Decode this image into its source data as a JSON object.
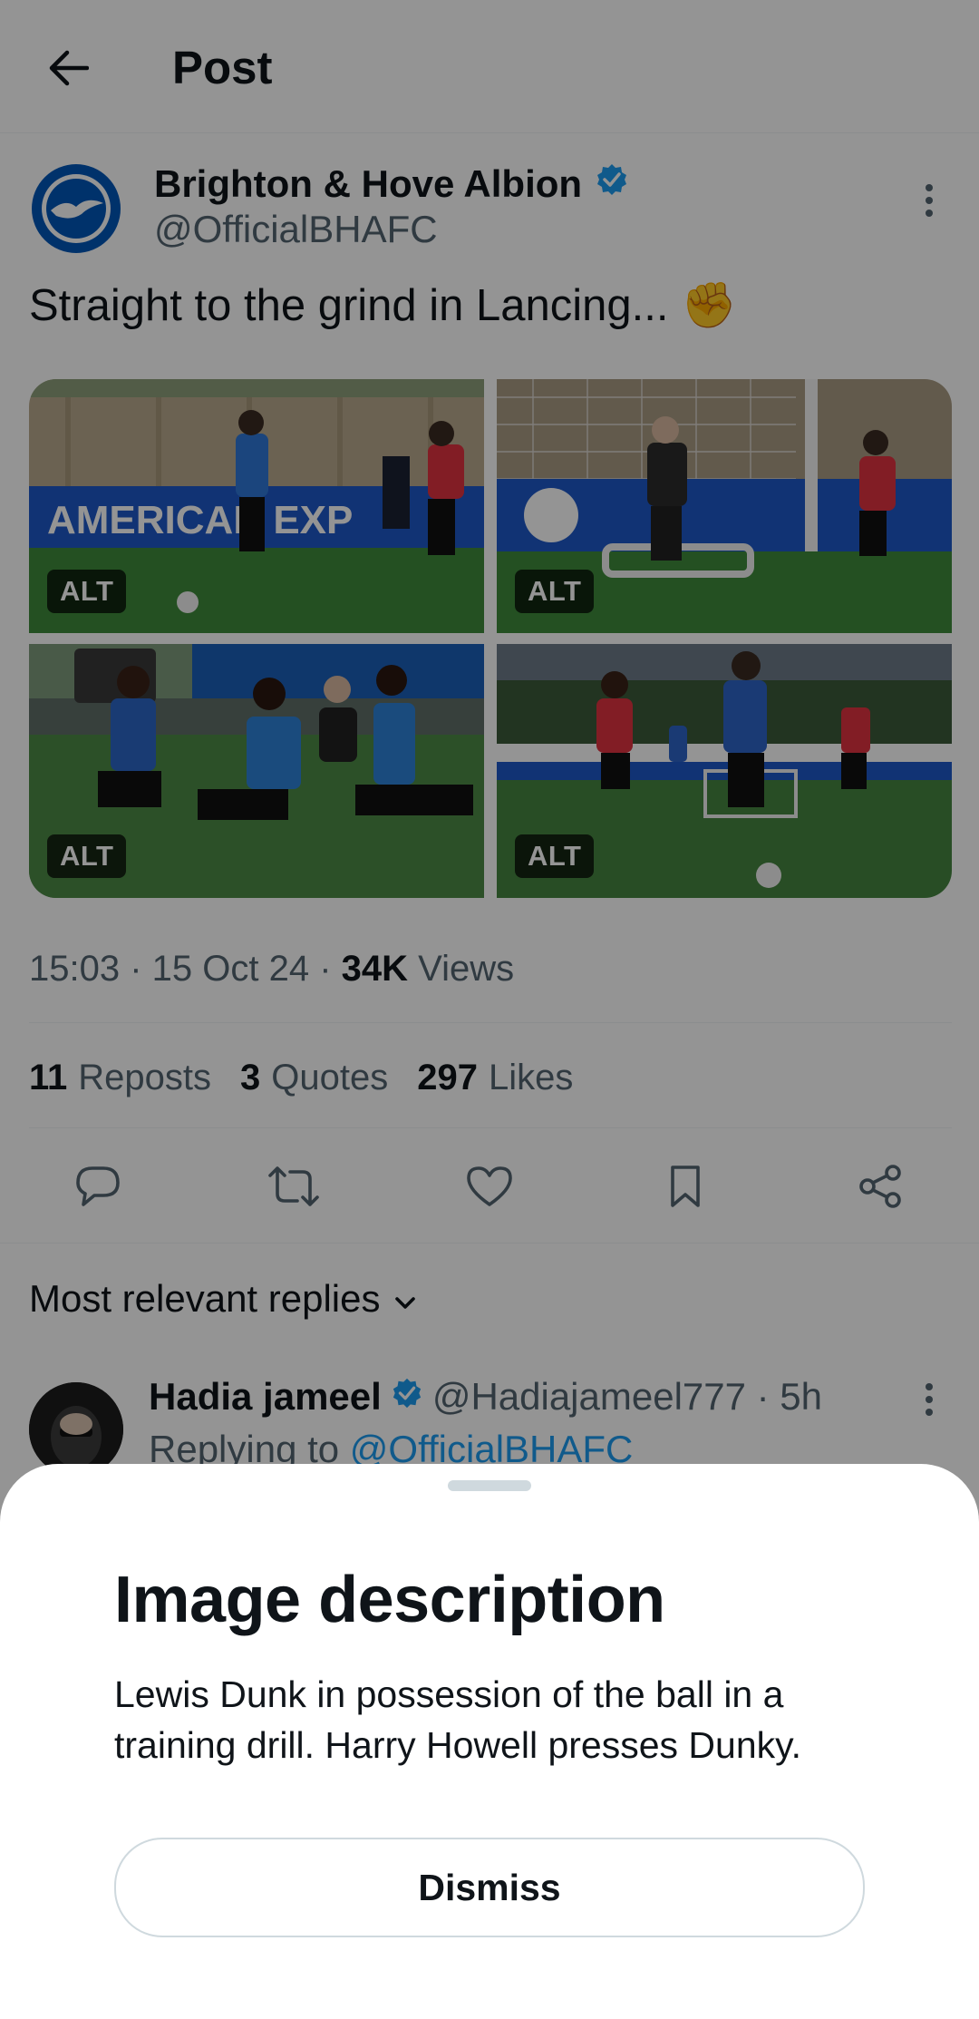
{
  "header": {
    "title": "Post"
  },
  "post": {
    "author_name": "Brighton & Hove Albion",
    "author_handle": "@OfficialBHAFC",
    "text": "Straight to the grind in Lancing...",
    "emoji": "✊",
    "media": [
      {
        "alt_label": "ALT"
      },
      {
        "alt_label": "ALT"
      },
      {
        "alt_label": "ALT"
      },
      {
        "alt_label": "ALT"
      }
    ],
    "meta": {
      "time_date": "15:03 · 15 Oct 24 · ",
      "views_count": "34K",
      "views_label": " Views"
    },
    "stats": [
      {
        "count": "11",
        "label": "Reposts"
      },
      {
        "count": "3",
        "label": "Quotes"
      },
      {
        "count": "297",
        "label": "Likes"
      }
    ],
    "verified_color": "#1d9bf0"
  },
  "replies": {
    "sort_label": "Most relevant replies",
    "first": {
      "name": "Hadia jameel",
      "handle_time": "@Hadiajameel777 · 5h",
      "replying_prefix": "Replying to ",
      "replying_to": "@OfficialBHAFC"
    }
  },
  "sheet": {
    "title": "Image description",
    "body": "Lewis Dunk in possession of the ball in a training drill. Harry Howell presses Dunky.",
    "dismiss_label": "Dismiss"
  }
}
